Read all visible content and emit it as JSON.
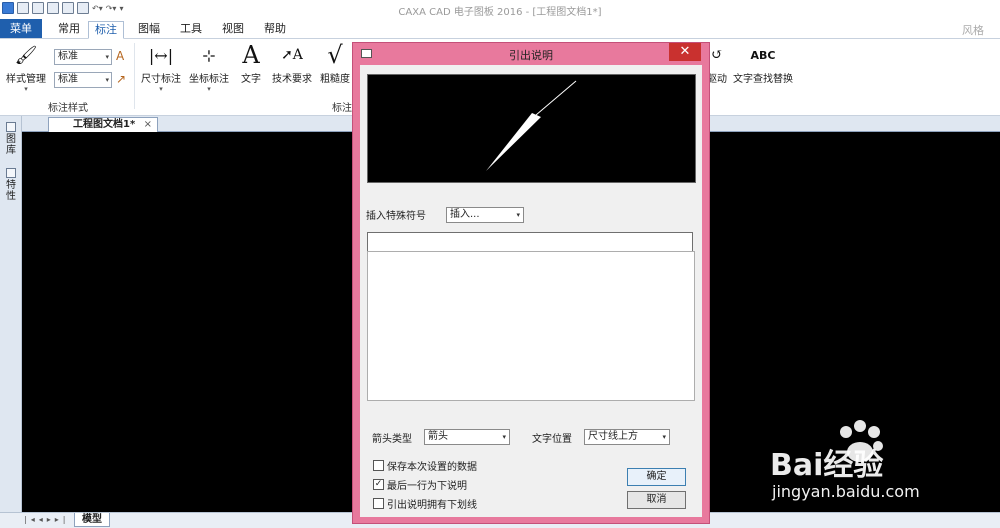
{
  "app_title": "CAXA CAD 电子图板 2016 - [工程图文档1*]",
  "window_style_label": "风格",
  "menu_tabs": [
    "菜单",
    "常用",
    "标注",
    "图幅",
    "工具",
    "视图",
    "帮助"
  ],
  "ribbon": {
    "style_manage_label": "样式管理",
    "style_select_1": "标准",
    "style_select_2": "标准",
    "style_group_label": "标注样式",
    "dimension_label": "尺寸标注",
    "coordinate_label": "坐标标注",
    "text_label": "文字",
    "tech_req_label": "技术要求",
    "roughness_label": "粗糙度",
    "annotation_group_label": "标注",
    "drive_label": "驱动",
    "text_find_replace_label": "文字查找替换"
  },
  "left_dock": {
    "item1": "图库",
    "item2": "特性"
  },
  "document_tab": "工程图文档1*",
  "bottom": {
    "model_tab": "模型"
  },
  "dialog": {
    "title": "引出说明",
    "insert_special_label": "插入特殊符号",
    "insert_dropdown_value": "插入...",
    "arrow_type_label": "箭头类型",
    "arrow_type_value": "箭头",
    "text_position_label": "文字位置",
    "text_position_value": "尺寸线上方",
    "checkbox_save": "保存本次设置的数据",
    "checkbox_last_line": "最后一行为下说明",
    "checkbox_underline": "引出说明拥有下划线",
    "ok_button": "确定",
    "cancel_button": "取消",
    "checkbox_states": {
      "save": false,
      "last_line": true,
      "underline": false
    }
  },
  "watermark": {
    "logo": "Bai经验",
    "url": "jingyan.baidu.com"
  }
}
